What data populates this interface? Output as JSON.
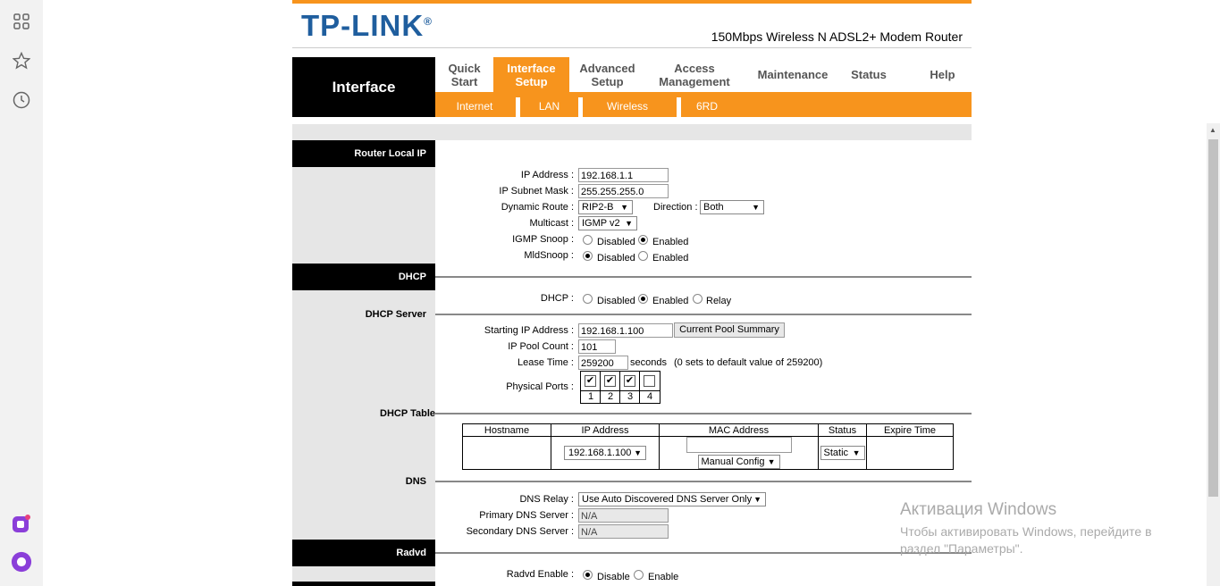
{
  "browser_sidebar": {
    "icons": [
      "grid-icon",
      "star-icon",
      "clock-icon",
      "app-icon",
      "alice-icon"
    ]
  },
  "header": {
    "logo": "TP-LINK",
    "model": "150Mbps Wireless N ADSL2+ Modem Router"
  },
  "nav": {
    "section_title": "Interface",
    "menu": [
      {
        "label": "Quick Start"
      },
      {
        "label": "Interface Setup"
      },
      {
        "label": "Advanced Setup"
      },
      {
        "label": "Access Management"
      },
      {
        "label": "Maintenance"
      },
      {
        "label": "Status"
      },
      {
        "label": "Help"
      }
    ],
    "submenu": [
      "Internet",
      "LAN",
      "Wireless",
      "6RD"
    ],
    "accent_color": "#f7941d"
  },
  "router_local_ip": {
    "section": "Router Local IP",
    "ip_address_label": "IP Address :",
    "ip_address": "192.168.1.1",
    "subnet_label": "IP Subnet Mask :",
    "subnet": "255.255.255.0",
    "dynamic_route_label": "Dynamic Route :",
    "dynamic_route": "RIP2-B",
    "direction_label": "Direction :",
    "direction": "Both",
    "multicast_label": "Multicast :",
    "multicast": "IGMP v2",
    "igmp_label": "IGMP Snoop :",
    "igmp_disabled": "Disabled",
    "igmp_enabled": "Enabled",
    "mld_label": "MldSnoop :",
    "mld_disabled": "Disabled",
    "mld_enabled": "Enabled"
  },
  "dhcp": {
    "section": "DHCP",
    "dhcp_label": "DHCP :",
    "opt_disabled": "Disabled",
    "opt_enabled": "Enabled",
    "opt_relay": "Relay",
    "server_section": "DHCP Server",
    "start_ip_label": "Starting IP Address :",
    "start_ip": "192.168.1.100",
    "pool_button": "Current Pool Summary",
    "pool_count_label": "IP Pool Count :",
    "pool_count": "101",
    "lease_label": "Lease Time :",
    "lease": "259200",
    "lease_unit": "seconds",
    "lease_note": "(0 sets to default value of 259200)",
    "ports_label": "Physical Ports :",
    "ports": [
      "1",
      "2",
      "3",
      "4"
    ],
    "check_mark": "✔",
    "table_section": "DHCP Table",
    "table_headers": [
      "Hostname",
      "IP Address",
      "MAC Address",
      "Status",
      "Expire Time"
    ],
    "table_ip": "192.168.1.100",
    "table_mac_mode": "Manual Config",
    "table_status": "Static"
  },
  "dns": {
    "section": "DNS",
    "relay_label": "DNS Relay :",
    "relay": "Use Auto Discovered DNS Server Only",
    "primary_label": "Primary DNS Server :",
    "primary": "N/A",
    "secondary_label": "Secondary DNS Server :",
    "secondary": "N/A"
  },
  "radvd": {
    "section": "Radvd",
    "enable_label": "Radvd Enable :",
    "opt_disable": "Disable",
    "opt_enable": "Enable"
  },
  "watermark": {
    "title": "Активация Windows",
    "subtitle": "Чтобы активировать Windows, перейдите в раздел \"Параметры\"."
  }
}
